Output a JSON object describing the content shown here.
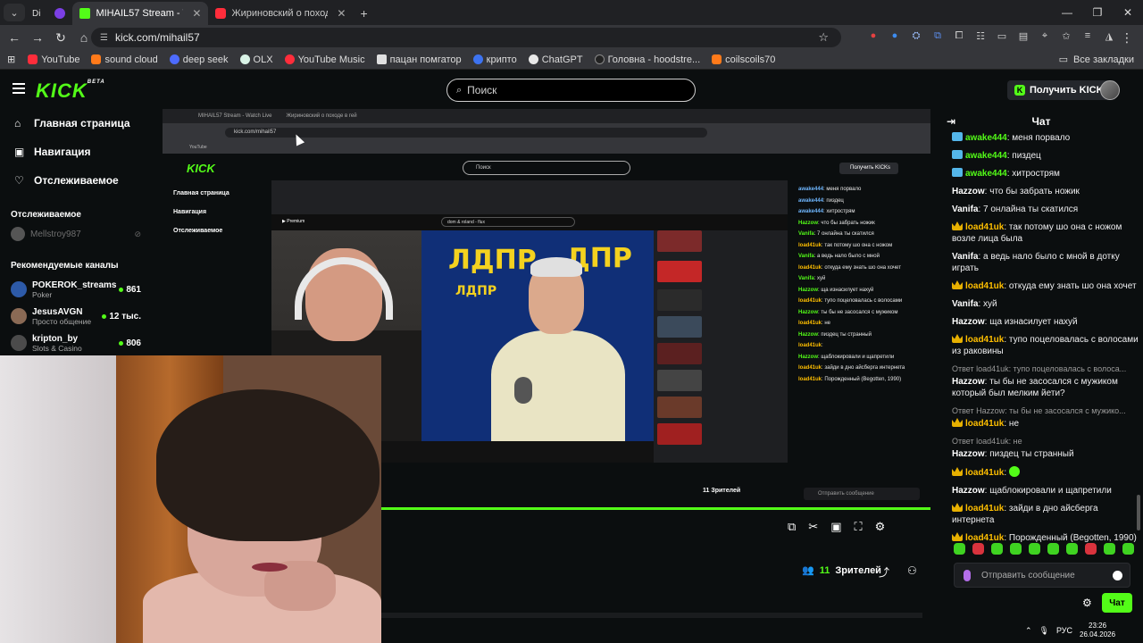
{
  "browser": {
    "tabs": [
      {
        "label": "MIHAIL57 Stream - Watch Live",
        "active": true
      },
      {
        "label": "Жириновский о походе в гей",
        "active": false
      }
    ],
    "url": "kick.com/mihail57",
    "bookmarks": [
      "YouTube",
      "sound cloud",
      "deep seek",
      "OLX",
      "YouTube Music",
      "пацан помгатор",
      "крипто",
      "ChatGPT",
      "Головна - hoodstre...",
      "coilscoils70"
    ],
    "all_bookmarks": "Все закладки"
  },
  "kick": {
    "search_placeholder": "Поиск",
    "get_kicks": "Получить KICKs",
    "nav": [
      "Главная страница",
      "Навигация",
      "Отслеживаемое"
    ],
    "following_title": "Отслеживаемое",
    "following_user": "Mellstroy987",
    "recommended_title": "Рекомендуемые каналы",
    "recommended": [
      {
        "name": "POKEROK_streams",
        "category": "Poker",
        "viewers": "861"
      },
      {
        "name": "JesusAVGN",
        "category": "Просто общение",
        "viewers": "12 тыс."
      },
      {
        "name": "kripton_by",
        "category": "Slots & Casino",
        "viewers": "806"
      }
    ]
  },
  "stream": {
    "viewers_count": "11",
    "viewers_label": "Зрителей",
    "inner_url": "kick.com/mihail57",
    "inner_search": "Поиск",
    "inner_kicks": "Получить KICKs",
    "inner_nav": [
      "Главная страница",
      "Навигация",
      "Отслеживаемое"
    ],
    "inner_viewers": "11 Зрителей",
    "inner_send": "Отправить сообщение",
    "inner_youtube_search": "dom & roland - flux",
    "inner_chat": [
      {
        "u": "awake444",
        "t": "меня порвало",
        "c": "c"
      },
      {
        "u": "awake444",
        "t": "пиздец",
        "c": "c"
      },
      {
        "u": "awake444",
        "t": "хитрострям",
        "c": "c"
      },
      {
        "u": "Hazzow",
        "t": "что бы забрать ножик",
        "c": ""
      },
      {
        "u": "Vanifa",
        "t": "7 онлайна ты скатился",
        "c": ""
      },
      {
        "u": "load41uk",
        "t": "так потому шо она с ножом",
        "c": "o"
      },
      {
        "u": "Vanifa",
        "t": "а ведь нало было с мной",
        "c": ""
      },
      {
        "u": "load41uk",
        "t": "откуда ему знать шо она хочет",
        "c": "o"
      },
      {
        "u": "Vanifa",
        "t": "хуй",
        "c": ""
      },
      {
        "u": "Hazzow",
        "t": "ща изнасилует нахуй",
        "c": ""
      },
      {
        "u": "load41uk",
        "t": "тупо поцеловалась с волосами",
        "c": "o"
      },
      {
        "u": "Hazzow",
        "t": "ты бы не засосался с мужиком",
        "c": ""
      },
      {
        "u": "load41uk",
        "t": "не",
        "c": "o"
      },
      {
        "u": "Hazzow",
        "t": "пиздец ты странный",
        "c": ""
      },
      {
        "u": "load41uk",
        "t": "",
        "c": "o"
      },
      {
        "u": "Hazzow",
        "t": "щаблокировали и щапретили",
        "c": ""
      },
      {
        "u": "load41uk",
        "t": "зайди в дно айсберга интернета",
        "c": "o"
      },
      {
        "u": "load41uk",
        "t": "Порожденный (Begotten, 1990)",
        "c": "o"
      }
    ]
  },
  "chat": {
    "title": "Чат",
    "messages": [
      {
        "badge": "cyan",
        "user": "awake444",
        "color": "#53fc18",
        "text": "меня порвало",
        "reply": ""
      },
      {
        "badge": "cyan",
        "user": "awake444",
        "color": "#53fc18",
        "text": "пиздец",
        "reply": ""
      },
      {
        "badge": "cyan",
        "user": "awake444",
        "color": "#53fc18",
        "text": "хитрострям",
        "reply": ""
      },
      {
        "badge": "none",
        "user": "Hazzow",
        "color": "#ffffff",
        "text": "что бы забрать ножик",
        "reply": ""
      },
      {
        "badge": "none",
        "user": "Vanifa",
        "color": "#ffffff",
        "text": "7 онлайна ты скатился",
        "reply": ""
      },
      {
        "badge": "crown",
        "user": "load41uk",
        "color": "#ffbf00",
        "text": "так потому шо она с ножом возле лица была",
        "reply": ""
      },
      {
        "badge": "none",
        "user": "Vanifa",
        "color": "#ffffff",
        "text": "а ведь нало было с мной в дотку играть",
        "reply": ""
      },
      {
        "badge": "crown",
        "user": "load41uk",
        "color": "#ffbf00",
        "text": "откуда ему знать шо она хочет",
        "reply": ""
      },
      {
        "badge": "none",
        "user": "Vanifa",
        "color": "#ffffff",
        "text": "хуй",
        "reply": ""
      },
      {
        "badge": "none",
        "user": "Hazzow",
        "color": "#ffffff",
        "text": "ща изнасилует нахуй",
        "reply": ""
      },
      {
        "badge": "crown",
        "user": "load41uk",
        "color": "#ffbf00",
        "text": "тупо поцеловалась с волосами из раковины",
        "reply": ""
      },
      {
        "badge": "none",
        "user": "Hazzow",
        "color": "#ffffff",
        "text": "ты бы не засосался с мужиком который был мелким йети?",
        "reply": "Ответ load41uk: тупо поцеловалась с волоса..."
      },
      {
        "badge": "crown",
        "user": "load41uk",
        "color": "#ffbf00",
        "text": "не",
        "reply": "Ответ Hazzow: ты бы не засосался с мужико..."
      },
      {
        "badge": "none",
        "user": "Hazzow",
        "color": "#ffffff",
        "text": "пиздец ты странный",
        "reply": "Ответ load41uk: не"
      },
      {
        "badge": "crown",
        "user": "load41uk",
        "color": "#ffbf00",
        "text": "",
        "reply": "",
        "emoji": true
      },
      {
        "badge": "none",
        "user": "Hazzow",
        "color": "#ffffff",
        "text": "щаблокировали и щапретили",
        "reply": ""
      },
      {
        "badge": "crown",
        "user": "load41uk",
        "color": "#ffbf00",
        "text": "зайди в дно айсберга интернета",
        "reply": ""
      },
      {
        "badge": "crown",
        "user": "load41uk",
        "color": "#ffbf00",
        "text": "Порожденный (Begotten, 1990)",
        "reply": ""
      }
    ],
    "send_placeholder": "Отправить сообщение",
    "chat_button": "Чат"
  },
  "system": {
    "lang": "РУС",
    "time": "23:26",
    "date": "26.04.2026"
  },
  "colors": {
    "accent": "#53fc18",
    "background": "#0b0e0f",
    "crown": "#e7b000"
  }
}
